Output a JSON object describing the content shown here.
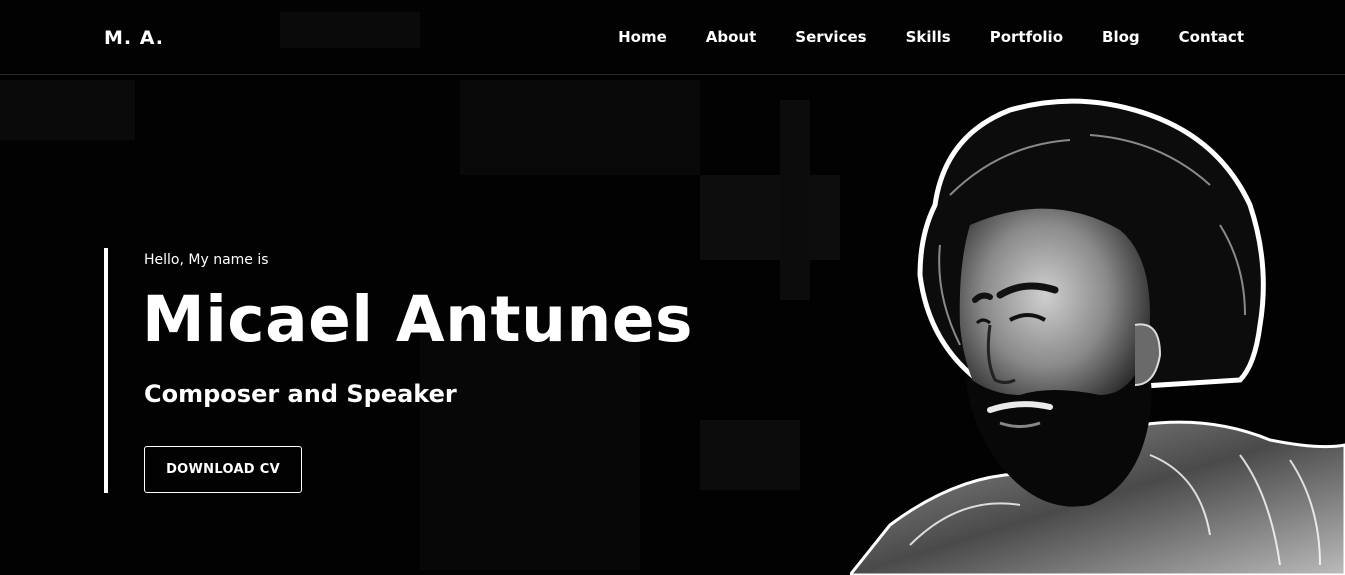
{
  "nav": {
    "logo": "M. A.",
    "links": [
      {
        "label": "Home"
      },
      {
        "label": "About"
      },
      {
        "label": "Services"
      },
      {
        "label": "Skills"
      },
      {
        "label": "Portfolio"
      },
      {
        "label": "Blog"
      },
      {
        "label": "Contact"
      }
    ]
  },
  "hero": {
    "greeting": "Hello, My name is",
    "name": "Micael Antunes",
    "subtitle": "Composer and Speaker",
    "button_label": "DOWNLOAD CV"
  },
  "colors": {
    "background": "#020202",
    "text": "#ffffff",
    "accent_bar": "#ffffff"
  },
  "icons": {
    "portrait": "portrait-illustration"
  }
}
